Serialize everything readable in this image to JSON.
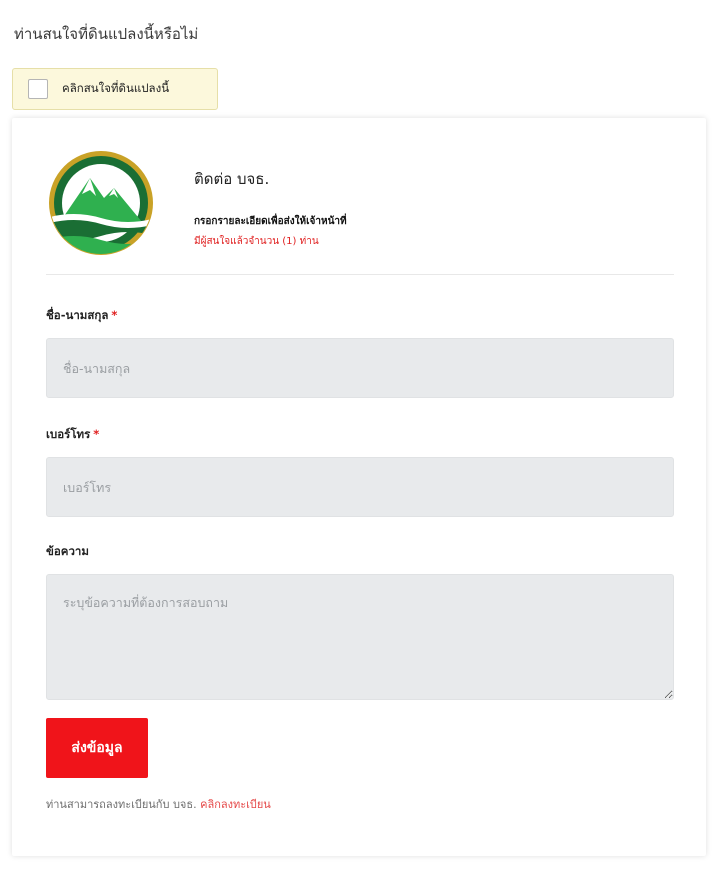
{
  "question": "ท่านสนใจที่ดินแปลงนี้หรือไม่",
  "interest": {
    "checked": false,
    "label": "คลิกสนใจที่ดินแปลงนี้"
  },
  "contact": {
    "title": "ติดต่อ บจธ.",
    "subtitle": "กรอกรายละเอียดเพื่อส่งให้เจ้าหน้าที่",
    "interested_count_text": "มีผู้สนใจแล้วจำนวน (1) ท่าน",
    "logo_icon": "organization-logo-mountain-icon"
  },
  "form": {
    "name": {
      "label": "ชื่อ-นามสกุล",
      "required_mark": "*",
      "value": "",
      "placeholder": "ชื่อ-นามสกุล"
    },
    "phone": {
      "label": "เบอร์โทร",
      "required_mark": "*",
      "value": "",
      "placeholder": "เบอร์โทร"
    },
    "message": {
      "label": "ข้อความ",
      "value": "",
      "placeholder": "ระบุข้อความที่ต้องการสอบถาม"
    },
    "submit_label": "ส่งข้อมูล"
  },
  "register": {
    "text": "ท่านสามารถลงทะเบียนกับ บจธ.",
    "link_text": "คลิกลงทะเบียน"
  },
  "colors": {
    "accent_red": "#f0141a",
    "link_red": "#e54848",
    "notice_bg": "#fcf8dc",
    "input_bg": "#e8eaec",
    "logo_green": "#1f8f3d",
    "logo_gold": "#c9a227"
  }
}
